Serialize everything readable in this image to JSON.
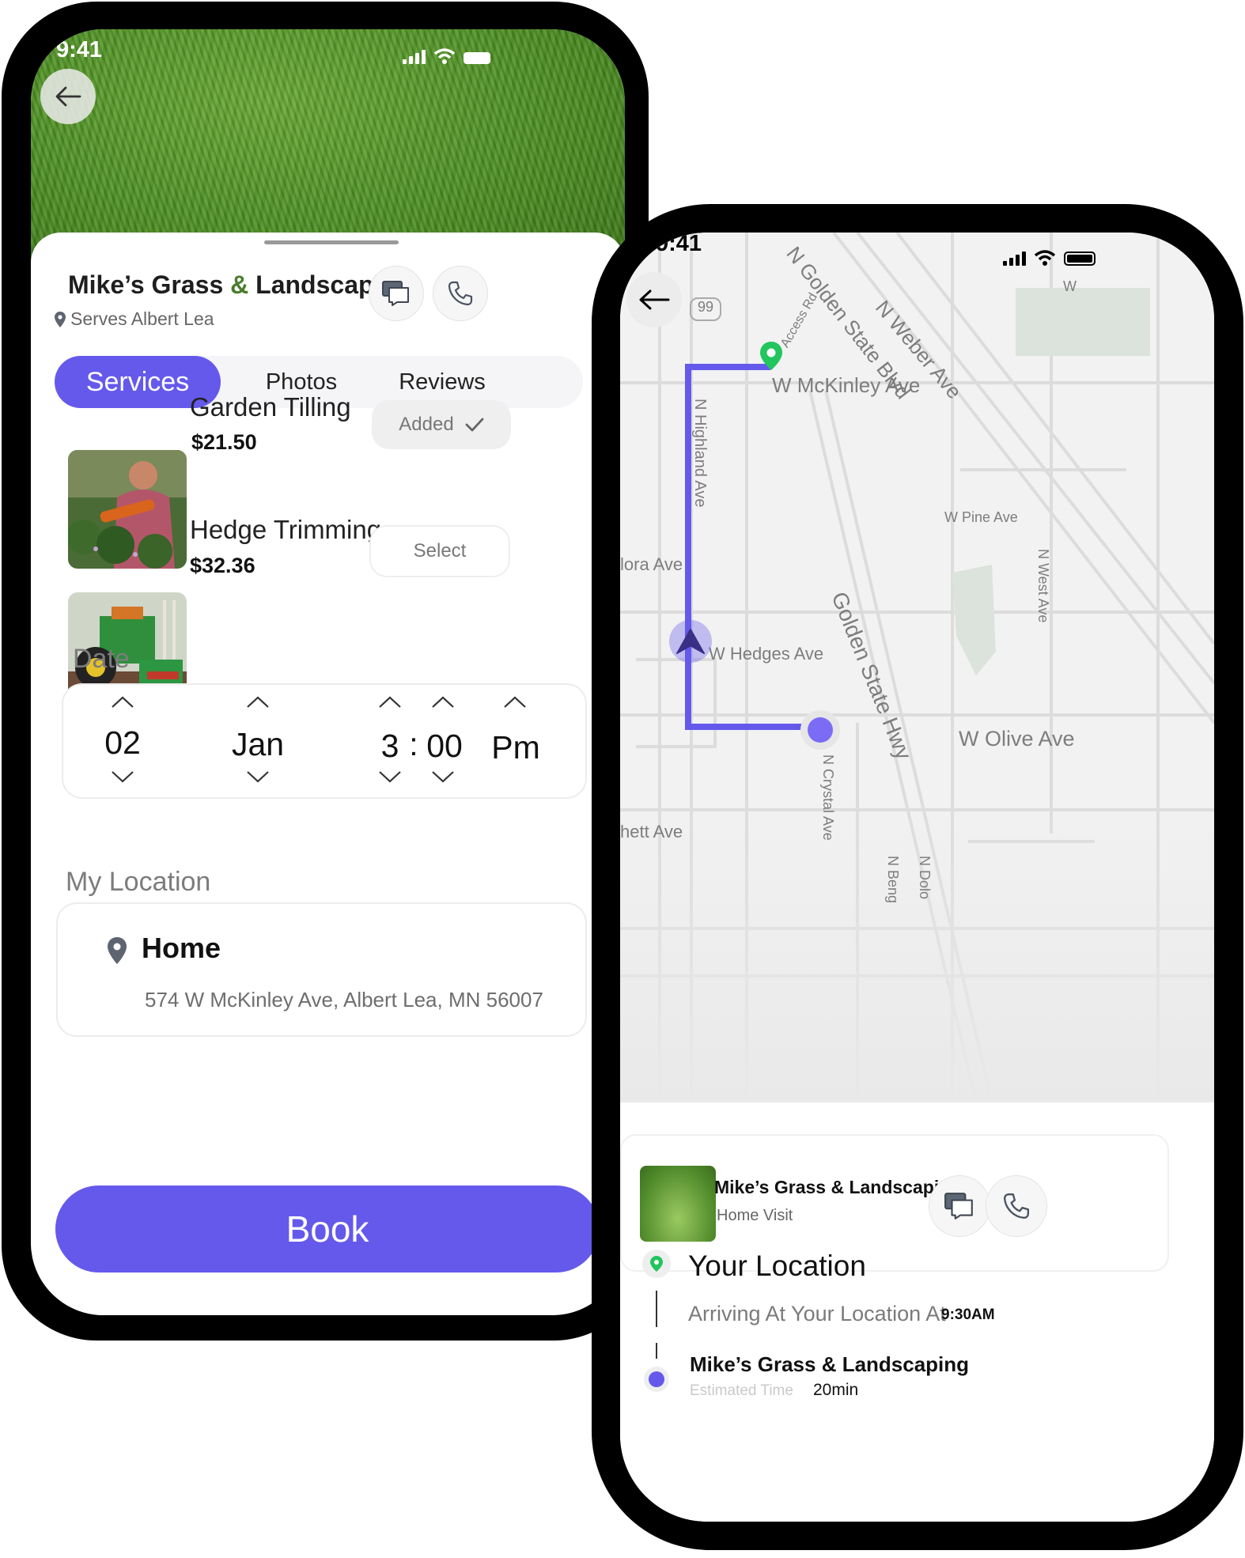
{
  "left_screen": {
    "status_time": "9:41",
    "business": {
      "name_part1": "Mike’s Grass ",
      "name_amp": "&",
      "name_part2": " Landscaping",
      "serves": "Serves Albert Lea"
    },
    "tabs": [
      {
        "label": "Services",
        "active": true
      },
      {
        "label": "Photos",
        "active": false
      },
      {
        "label": "Reviews",
        "active": false
      }
    ],
    "services": [
      {
        "name": "Garden Tilling",
        "price": "$21.50",
        "action": "Added",
        "selected": true
      },
      {
        "name": "Hedge Trimming",
        "price": "$32.36",
        "action": "Select",
        "selected": false
      }
    ],
    "date_label": "Date",
    "date": {
      "day": "02",
      "month": "Jan",
      "hour": "3",
      "sep": ":",
      "minute": "00",
      "period": "Pm"
    },
    "location_label": "My Location",
    "location": {
      "name": "Home",
      "address": "574 W McKinley Ave, Albert Lea, MN 56007"
    },
    "book_label": "Book"
  },
  "right_screen": {
    "status_time": "9:41",
    "map_labels": {
      "golden_state_blvd": "N Golden State Blvd",
      "weber_ave": "N Weber Ave",
      "access_rd": "Access Rd",
      "route_99": "99",
      "mckinley": "W McKinley Ave",
      "pine": "W Pine Ave",
      "lora": "lora Ave",
      "hedges": "W Hedges Ave",
      "golden_state_hwy": "Golden State Hwy",
      "olive": "W Olive Ave",
      "west_ave": "N West Ave",
      "crystal": "N Crystal Ave",
      "hett": "hett Ave",
      "beng": "N Beng",
      "dolo": "N Dolo",
      "highland": "N Highland Ave",
      "edge_w": "W"
    },
    "provider": {
      "name": "Mike’s Grass & Landscaping",
      "subtitle": "Home Visit"
    },
    "timeline": {
      "your_location_title": "Your Location",
      "arriving_text": "Arriving At Your Location At",
      "arriving_time": "9:30AM",
      "provider_name": "Mike’s Grass & Landscaping",
      "estimated_label": "Estimated Time",
      "estimated_value": "20min"
    }
  },
  "colors": {
    "accent": "#6559ec",
    "green_pin": "#22c55e",
    "phone_frame": "#000000",
    "route": "#6559ec"
  },
  "icons": [
    "back-arrow-icon",
    "chat-icon",
    "phone-icon",
    "location-pin-icon",
    "check-icon",
    "chevron-up-icon",
    "chevron-down-icon",
    "signal-icon",
    "wifi-icon",
    "battery-icon",
    "navigation-arrow-icon"
  ]
}
